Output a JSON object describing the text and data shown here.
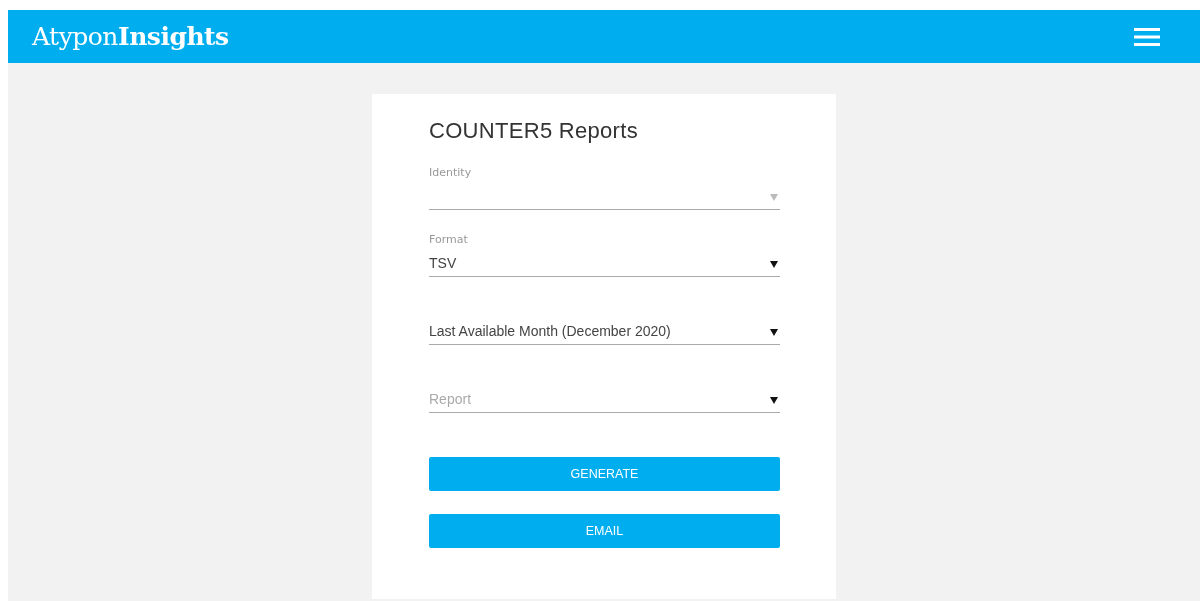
{
  "header": {
    "logo": "Atypon**Insights**"
  },
  "card": {
    "title": "COUNTER5 Reports",
    "fields": [
      {
        "label": "Identity",
        "disabled": true
      },
      {
        "label": "Format",
        "value": "TSV",
        "disabled": false
      },
      {
        "value": "Last Available Month (December 2020)",
        "disabled": false
      },
      {
        "placeholder": "Report",
        "disabled": false
      }
    ],
    "buttons": [
      "GENERATE",
      "EMAIL"
    ]
  }
}
